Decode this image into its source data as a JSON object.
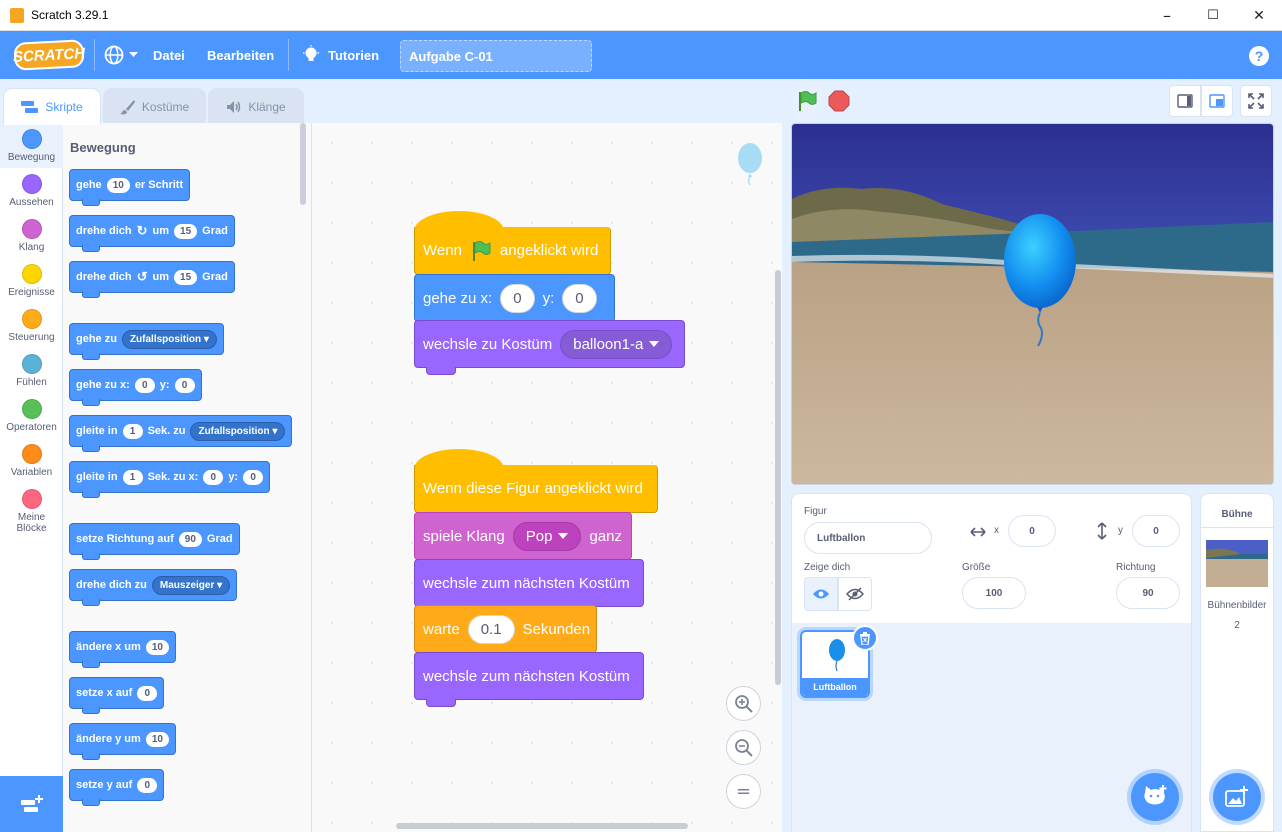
{
  "window": {
    "title": "Scratch 3.29.1",
    "minimize": "–",
    "maximize": "☐",
    "close": "✕"
  },
  "menubar": {
    "logo": "SCRATCH",
    "language_icon": "globe-icon",
    "file": "Datei",
    "edit": "Bearbeiten",
    "tutorials": "Tutorien",
    "project_title": "Aufgabe C-01",
    "help": "?"
  },
  "tabs": {
    "code": "Skripte",
    "costumes": "Kostüme",
    "sounds": "Klänge"
  },
  "categories": [
    {
      "label": "Bewegung",
      "color": "#4c97ff"
    },
    {
      "label": "Aussehen",
      "color": "#9966ff"
    },
    {
      "label": "Klang",
      "color": "#cf63cf"
    },
    {
      "label": "Ereignisse",
      "color": "#ffd500"
    },
    {
      "label": "Steuerung",
      "color": "#ffab19"
    },
    {
      "label": "Fühlen",
      "color": "#5cb1d6"
    },
    {
      "label": "Operatoren",
      "color": "#59c059"
    },
    {
      "label": "Variablen",
      "color": "#ff8c1a"
    },
    {
      "label": "Meine",
      "label2": "Blöcke",
      "color": "#ff6680"
    }
  ],
  "palette": {
    "title": "Bewegung",
    "b1": {
      "a": "gehe",
      "n": "10",
      "b": "er Schritt"
    },
    "b2": {
      "a": "drehe dich",
      "b": "um",
      "n": "15",
      "c": "Grad"
    },
    "b3": {
      "a": "drehe dich",
      "b": "um",
      "n": "15",
      "c": "Grad"
    },
    "b4": {
      "a": "gehe zu",
      "d": "Zufallsposition"
    },
    "b5": {
      "a": "gehe zu x:",
      "n1": "0",
      "b": "y:",
      "n2": "0"
    },
    "b6": {
      "a": "gleite in",
      "n": "1",
      "b": "Sek. zu",
      "d": "Zufallsposition"
    },
    "b7": {
      "a": "gleite in",
      "n": "1",
      "b": "Sek. zu x:",
      "n1": "0",
      "c": "y:",
      "n2": "0"
    },
    "b8": {
      "a": "setze Richtung auf",
      "n": "90",
      "b": "Grad"
    },
    "b9": {
      "a": "drehe dich zu",
      "d": "Mauszeiger"
    },
    "b10": {
      "a": "ändere x um",
      "n": "10"
    },
    "b11": {
      "a": "setze x auf",
      "n": "0"
    },
    "b12": {
      "a": "ändere y um",
      "n": "10"
    },
    "b13": {
      "a": "setze y auf",
      "n": "0"
    }
  },
  "script1": {
    "hat_a": "Wenn",
    "hat_b": "angeklickt wird",
    "goto_a": "gehe zu x:",
    "goto_x": "0",
    "goto_b": "y:",
    "goto_y": "0",
    "costume_a": "wechsle zu Kostüm",
    "costume_d": "balloon1-a"
  },
  "script2": {
    "hat": "Wenn diese Figur angeklickt wird",
    "sound_a": "spiele Klang",
    "sound_d": "Pop",
    "sound_b": "ganz",
    "next1": "wechsle zum nächsten Kostüm",
    "wait_a": "warte",
    "wait_n": "0.1",
    "wait_b": "Sekunden",
    "next2": "wechsle zum nächsten Kostüm"
  },
  "zoom": {
    "in": "+",
    "out": "−",
    "reset": "="
  },
  "sprite_info": {
    "sprite_label": "Figur",
    "sprite_name": "Luftballon",
    "x_label": "x",
    "x_value": "0",
    "y_label": "y",
    "y_value": "0",
    "show_label": "Zeige dich",
    "size_label": "Größe",
    "size_value": "100",
    "direction_label": "Richtung",
    "direction_value": "90"
  },
  "sprites": [
    {
      "name": "Luftballon"
    }
  ],
  "stage_panel": {
    "title": "Bühne",
    "backdrops_label": "Bühnenbilder",
    "backdrops_count": "2"
  }
}
